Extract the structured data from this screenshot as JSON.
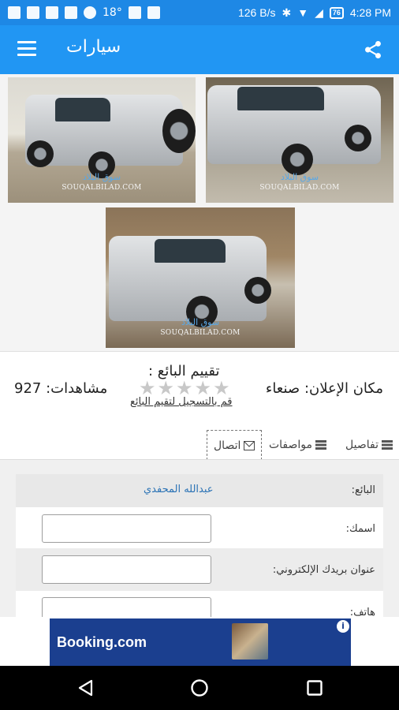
{
  "status_bar": {
    "temperature": "18°",
    "network_speed": "126 B/s",
    "battery": "76",
    "time": "4:28 PM"
  },
  "app_bar": {
    "title": "سيارات"
  },
  "gallery": {
    "watermark_text": "SOUQALBILAD.COM",
    "watermark_ar": "سوق البلاد"
  },
  "info": {
    "views_label": "مشاهدات:",
    "views_count": "927",
    "rating_title": "تقييم البائع :",
    "rating_stars": 0,
    "rating_max": 5,
    "rate_link": "قم بالتسجيل لتقيم البائع",
    "location_label": "مكان الإعلان:",
    "location_value": "صنعاء"
  },
  "tabs": [
    {
      "label": "تفاصيل",
      "icon": "list-icon"
    },
    {
      "label": "مواصفات",
      "icon": "list-icon"
    },
    {
      "label": "اتصال",
      "icon": "envelope-icon"
    }
  ],
  "form": {
    "seller_label": "البائع:",
    "seller_name": "عبدالله المحفدي",
    "name_label": "اسمك:",
    "name_value": "",
    "email_label": "عنوان بريدك الإلكتروني:",
    "email_value": "",
    "phone_label": "هاتف:",
    "phone_value": ""
  },
  "ad": {
    "brand": "Booking.com",
    "info": "i"
  },
  "colors": {
    "primary": "#2196f3",
    "status_bar": "#1e88e5",
    "ad_background": "#1b3f8f"
  }
}
